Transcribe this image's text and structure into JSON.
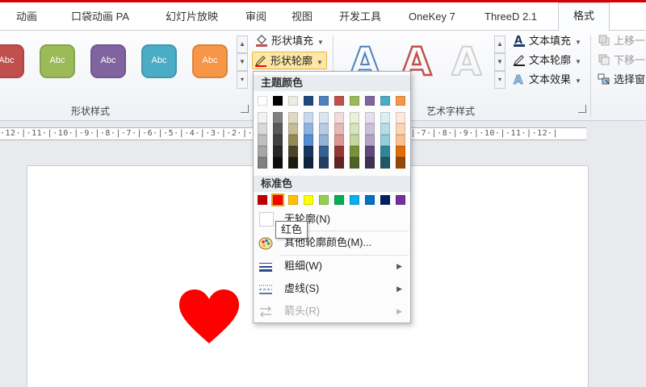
{
  "tabs": [
    "动画",
    "口袋动画 PA",
    "幻灯片放映",
    "审阅",
    "视图",
    "开发工具",
    "OneKey 7",
    "ThreeD 2.1",
    "格式"
  ],
  "ribbon": {
    "shape_styles": {
      "group_label": "形状样式",
      "sample_text": "Abc",
      "sample_colors": [
        "#c0504d",
        "#9bbb59",
        "#8064a2",
        "#4bacc6",
        "#f79646"
      ]
    },
    "shape_fill_label": "形状填充",
    "shape_outline_label": "形状轮廓",
    "wordart": {
      "group_label": "艺术字样式",
      "sample_letter": "A",
      "text_fill_label": "文本填充",
      "text_outline_label": "文本轮廓",
      "text_effects_label": "文本效果"
    },
    "arrange": {
      "bring_forward_label": "上移一",
      "send_backward_label": "下移一",
      "selection_pane_label": "选择窗"
    }
  },
  "ruler_text": "·12·|·11·|·10·|·9·|·8·|·7·|·6·|·5·|·4·|·3·|·2·|·1·|·0·|·1·|·2·|·3·|·4·|·5·|·6·|·7·|·8·|·9·|·10·|·11·|·12·|",
  "menu": {
    "theme_colors_heading": "主题颜色",
    "theme_colors": [
      [
        "#ffffff",
        "#f2f2f2",
        "#d9d9d9",
        "#bfbfbf",
        "#a6a6a6",
        "#808080"
      ],
      [
        "#000000",
        "#808080",
        "#595959",
        "#404040",
        "#262626",
        "#0d0d0d"
      ],
      [
        "#eeece1",
        "#ddd9c3",
        "#c4bd97",
        "#948a54",
        "#4a452a",
        "#1e1c11"
      ],
      [
        "#1f497d",
        "#c6d9f0",
        "#8db3e2",
        "#548dd4",
        "#17365d",
        "#0f243e"
      ],
      [
        "#4f81bd",
        "#dbe5f1",
        "#b8cce4",
        "#95b3d7",
        "#366092",
        "#244061"
      ],
      [
        "#c0504d",
        "#f2dcdb",
        "#e5b9b7",
        "#d99694",
        "#953734",
        "#632423"
      ],
      [
        "#9bbb59",
        "#ebf1dd",
        "#d7e3bc",
        "#c3d69b",
        "#76923c",
        "#4f6128"
      ],
      [
        "#8064a2",
        "#e5e0ec",
        "#ccc1d9",
        "#b2a2c7",
        "#5f497a",
        "#3f3151"
      ],
      [
        "#4bacc6",
        "#dbeef3",
        "#b7dde8",
        "#92cddc",
        "#31859b",
        "#205867"
      ],
      [
        "#f79646",
        "#fdeada",
        "#fbd5b5",
        "#fac08f",
        "#e36c09",
        "#974806"
      ]
    ],
    "standard_colors_heading": "标准色",
    "standard_colors": [
      "#c00000",
      "#ff0000",
      "#ffc000",
      "#ffff00",
      "#92d050",
      "#00b050",
      "#00b0f0",
      "#0070c0",
      "#002060",
      "#7030a0"
    ],
    "selected_standard_color": "#ff0000",
    "no_outline_label": "无轮廓(N)",
    "more_colors_label": "其他轮廓颜色(M)...",
    "weight_label": "粗细(W)",
    "dashes_label": "虚线(S)",
    "arrows_label": "箭头(R)"
  },
  "tooltip_text": "红色",
  "slide": {
    "heart_color": "#ff0000"
  }
}
